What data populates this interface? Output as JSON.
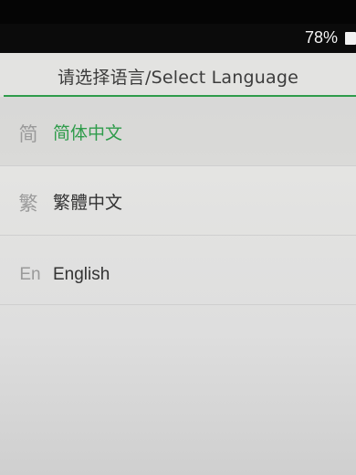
{
  "status_bar": {
    "battery_percent": "78%"
  },
  "header": {
    "title": "请选择语言/Select Language"
  },
  "languages": [
    {
      "icon": "简",
      "label": "简体中文",
      "selected": true
    },
    {
      "icon": "繁",
      "label": "繁體中文",
      "selected": false
    },
    {
      "icon": "En",
      "label": "English",
      "selected": false
    }
  ],
  "colors": {
    "accent": "#2f9c4b"
  }
}
